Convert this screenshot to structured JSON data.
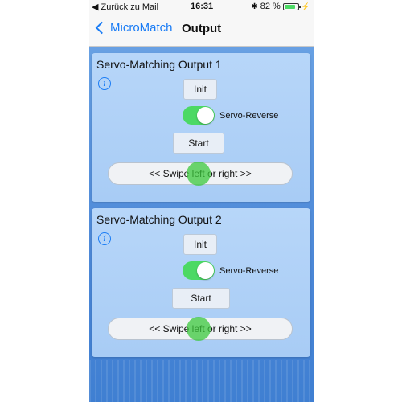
{
  "status_bar": {
    "back_app": "◀ Zurück zu Mail",
    "time": "16:31",
    "battery_percent": "82 %",
    "battery_level": 0.82
  },
  "nav": {
    "back_label": "MicroMatch",
    "title": "Output"
  },
  "outputs": [
    {
      "title": "Servo-Matching Output 1",
      "init_label": "Init",
      "reverse_label": "Servo-Reverse",
      "reverse_on": true,
      "start_label": "Start",
      "swipe_label": "<< Swipe left or right >>"
    },
    {
      "title": "Servo-Matching Output 2",
      "init_label": "Init",
      "reverse_label": "Servo-Reverse",
      "reverse_on": true,
      "start_label": "Start",
      "swipe_label": "<< Swipe left or right >>"
    }
  ],
  "colors": {
    "accent": "#1a7cf5",
    "toggle_on": "#4cd964",
    "card_bg": "#b7d6f9",
    "background": "#4a86d6"
  },
  "icons": {
    "info": "info-icon",
    "back": "chevron-left-icon",
    "bluetooth": "bluetooth-icon",
    "battery": "battery-icon",
    "charging": "charging-icon"
  }
}
